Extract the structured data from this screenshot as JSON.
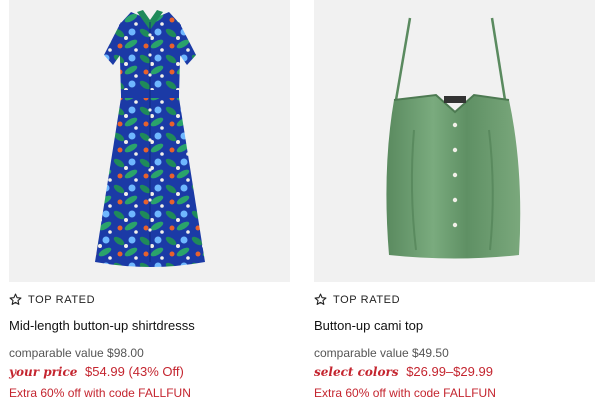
{
  "products": [
    {
      "badge": "TOP RATED",
      "title": "Mid-length button-up shirtdresss",
      "comparable": "comparable value $98.00",
      "price_label": "your price",
      "price": "$54.99",
      "discount": "(43% Off)",
      "promo": "Extra 60% off with code FALLFUN",
      "colors": {
        "print_base": "#1b3aa6",
        "leaf": "#1f8a5a",
        "bg": "#f1f1f1"
      }
    },
    {
      "badge": "TOP RATED",
      "title": "Button-up cami top",
      "comparable": "comparable value $49.50",
      "price_label": "select colors",
      "price": "$26.99–$29.99",
      "discount": "",
      "promo": "Extra 60% off with code FALLFUN",
      "colors": {
        "satin": "#6a9a6f",
        "bg": "#f1f1f1"
      }
    }
  ],
  "colors": {
    "sale_red": "#c4252f",
    "text": "#222222",
    "muted": "#555555"
  }
}
